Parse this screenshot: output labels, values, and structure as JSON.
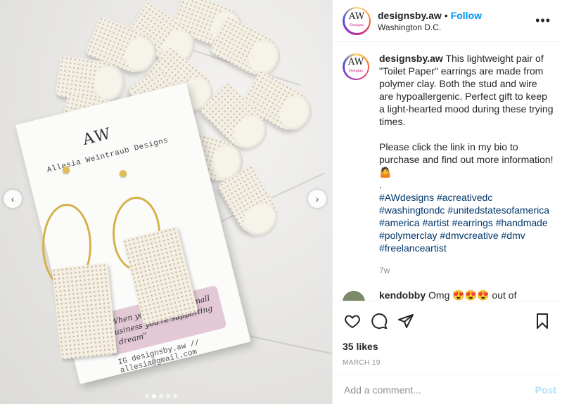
{
  "photo": {
    "card_brand": "Allesia Weintraub Designs",
    "card_mark": "AW",
    "card_quote": "\"When you support a small business you're supporting a dream\"",
    "card_handle": "IG designsby.aw // allesia@gmail.com",
    "prev_arrow": "‹",
    "next_arrow": "›",
    "carousel_count": 5,
    "carousel_active": 1
  },
  "header": {
    "username": "designsby.aw",
    "separator": "•",
    "follow_label": "Follow",
    "location": "Washington D.C.",
    "more_icon": "•••",
    "avatar_text": "AW",
    "avatar_sub": "Designs"
  },
  "caption": {
    "username": "designsby.aw",
    "text_1": "This lightweight pair of \"Toilet Paper\" earrings are made from polymer clay. Both the stud and wire are hypoallergenic. Perfect gift to keep a light-hearted mood during these trying times.",
    "text_2": "Please click the link in my bio to purchase and find out more information! 🤷",
    "text_3": ".",
    "hashtags": [
      "#AWdesigns",
      "#acreativedc",
      "#washingtondc",
      "#unitedstatesofamerica",
      "#america",
      "#artist",
      "#earrings",
      "#handmade",
      "#polymerclay",
      "#dmvcreative",
      "#dmv",
      "#freelanceartist"
    ],
    "time_ago": "7w"
  },
  "comment": {
    "username": "kendobby",
    "text": "Omg 😍😍😍 out of"
  },
  "actions": {
    "likes": "35 likes",
    "date": "MARCH 19"
  },
  "add_comment": {
    "placeholder": "Add a comment...",
    "post_label": "Post"
  },
  "colors": {
    "link_blue": "#0095f6",
    "hashtag": "#00376b",
    "muted": "#8e8e8e",
    "post_disabled": "#b2dffc"
  }
}
